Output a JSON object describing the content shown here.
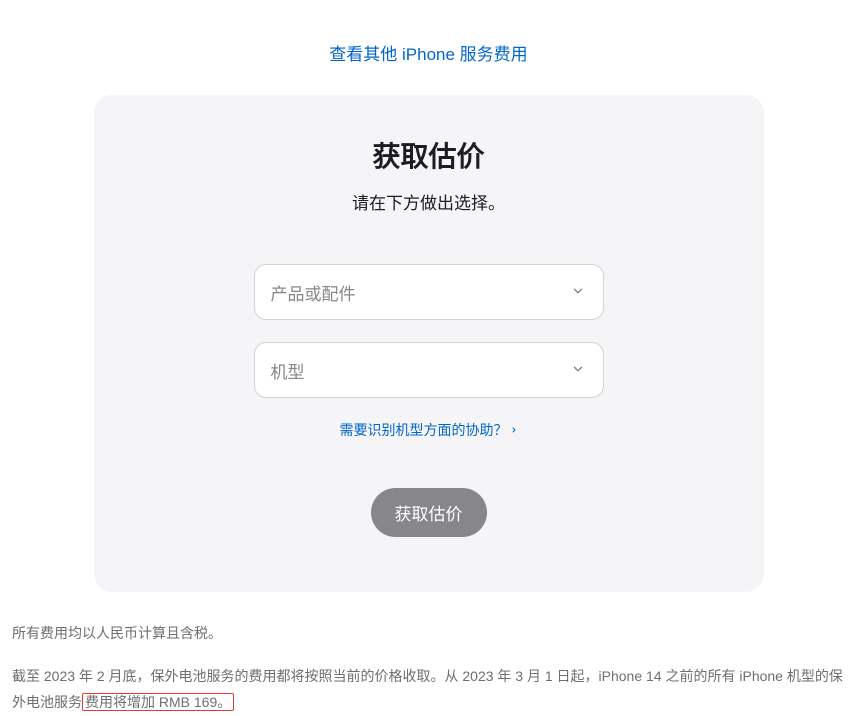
{
  "topLink": {
    "label": "查看其他 iPhone 服务费用"
  },
  "card": {
    "title": "获取估价",
    "subtext": "请在下方做出选择。",
    "productSelect": {
      "placeholder": "产品或配件"
    },
    "modelSelect": {
      "placeholder": "机型"
    },
    "helpLink": {
      "label": "需要识别机型方面的协助？"
    },
    "submitButton": {
      "label": "获取估价"
    }
  },
  "footer": {
    "note1": "所有费用均以人民币计算且含税。",
    "note2_part1": "截至 2023 年 2 月底，保外电池服务的费用都将按照当前的价格收取。从 2023 年 3 月 1 日起，iPhone 14 之前的所有 iPhone 机型的保外电池服务",
    "note2_highlight": "费用将增加 RMB 169。"
  }
}
